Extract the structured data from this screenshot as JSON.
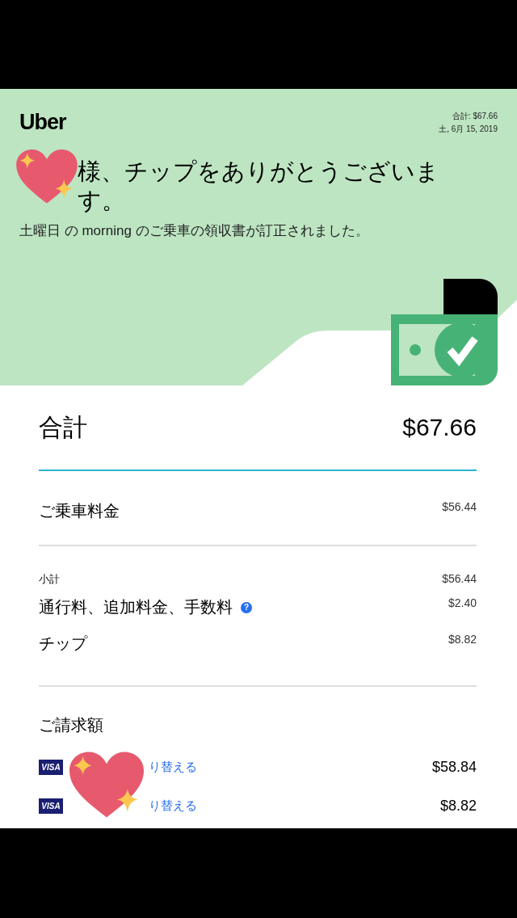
{
  "header": {
    "logo": "Uber",
    "total": "合計: $67.66",
    "date": "土, 6月 15, 2019",
    "title": "様、チップをありがとうございます。",
    "subtitle": "土曜日 の morning のご乗車の領収書が訂正されました。"
  },
  "total": {
    "label": "合計",
    "amount": "$67.66"
  },
  "fare": {
    "label": "ご乗車料金",
    "amount": "$56.44"
  },
  "lines": [
    {
      "kind": "small",
      "label": "小計",
      "amount": "$56.44"
    },
    {
      "kind": "normal",
      "label": "通行料、追加料金、手数料",
      "amount": "$2.40",
      "info": "?"
    },
    {
      "kind": "normal",
      "label": "チップ",
      "amount": "$8.82"
    }
  ],
  "charges": {
    "title": "ご請求額",
    "payments": [
      {
        "card": "VISA",
        "link": "り替える",
        "amount": "$58.84"
      },
      {
        "card": "VISA",
        "link": "り替える",
        "amount": "$8.82"
      }
    ]
  }
}
